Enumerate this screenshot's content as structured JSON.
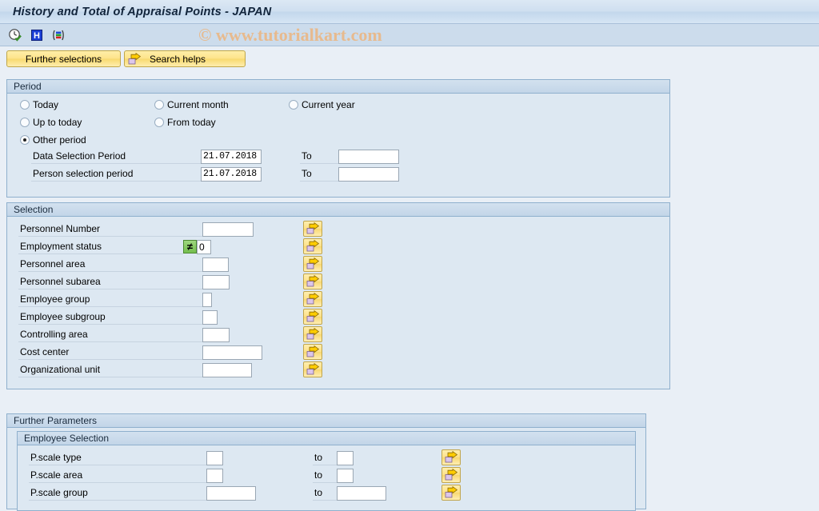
{
  "window": {
    "title": "History and Total of Appraisal Points - JAPAN"
  },
  "watermark": "© www.tutorialkart.com",
  "toolbar": {
    "icons": [
      {
        "name": "execute-clock-icon",
        "title": "Execute"
      },
      {
        "name": "info-icon",
        "title": "Information"
      },
      {
        "name": "variant-icon",
        "title": "Get Variant"
      }
    ]
  },
  "buttonbar": {
    "further_selections": "Further selections",
    "search_helps": "Search helps"
  },
  "period": {
    "title": "Period",
    "options": [
      {
        "label": "Today",
        "checked": false
      },
      {
        "label": "Current month",
        "checked": false
      },
      {
        "label": "Current year",
        "checked": false
      },
      {
        "label": "Up to today",
        "checked": false
      },
      {
        "label": "From today",
        "checked": false
      },
      {
        "label": "Other period",
        "checked": true
      }
    ],
    "rows": [
      {
        "label": "Data Selection Period",
        "value": "21.07.2018",
        "to_label": "To",
        "to_value": ""
      },
      {
        "label": "Person selection period",
        "value": "21.07.2018",
        "to_label": "To",
        "to_value": ""
      }
    ]
  },
  "selection": {
    "title": "Selection",
    "rows": [
      {
        "label": "Personnel Number",
        "value": "",
        "operator": "",
        "has_arrow": true
      },
      {
        "label": "Employment status",
        "value": "0",
        "operator": "≠",
        "has_arrow": true
      },
      {
        "label": "Personnel area",
        "value": "",
        "operator": "",
        "has_arrow": true
      },
      {
        "label": "Personnel subarea",
        "value": "",
        "operator": "",
        "has_arrow": true
      },
      {
        "label": "Employee group",
        "value": "",
        "operator": "",
        "has_arrow": true
      },
      {
        "label": "Employee subgroup",
        "value": "",
        "operator": "",
        "has_arrow": true
      },
      {
        "label": "Controlling area",
        "value": "",
        "operator": "",
        "has_arrow": true
      },
      {
        "label": "Cost center",
        "value": "",
        "operator": "",
        "has_arrow": true
      },
      {
        "label": "Organizational unit",
        "value": "",
        "operator": "",
        "has_arrow": true
      }
    ]
  },
  "further_parameters": {
    "title": "Further Parameters",
    "employee_selection": {
      "title": "Employee Selection",
      "rows": [
        {
          "label": "P.scale type",
          "value": "",
          "to_label": "to",
          "to_value": ""
        },
        {
          "label": "P.scale area",
          "value": "",
          "to_label": "to",
          "to_value": ""
        },
        {
          "label": "P.scale group",
          "value": "",
          "to_label": "to",
          "to_value": ""
        }
      ]
    }
  },
  "colors": {
    "page_background": "#e9eff6",
    "panel_background": "#dde8f2",
    "panel_border": "#8fb0cd",
    "button_yellow": "#fde389",
    "operator_green": "#74bf4e",
    "watermark": "#e9b98a"
  }
}
